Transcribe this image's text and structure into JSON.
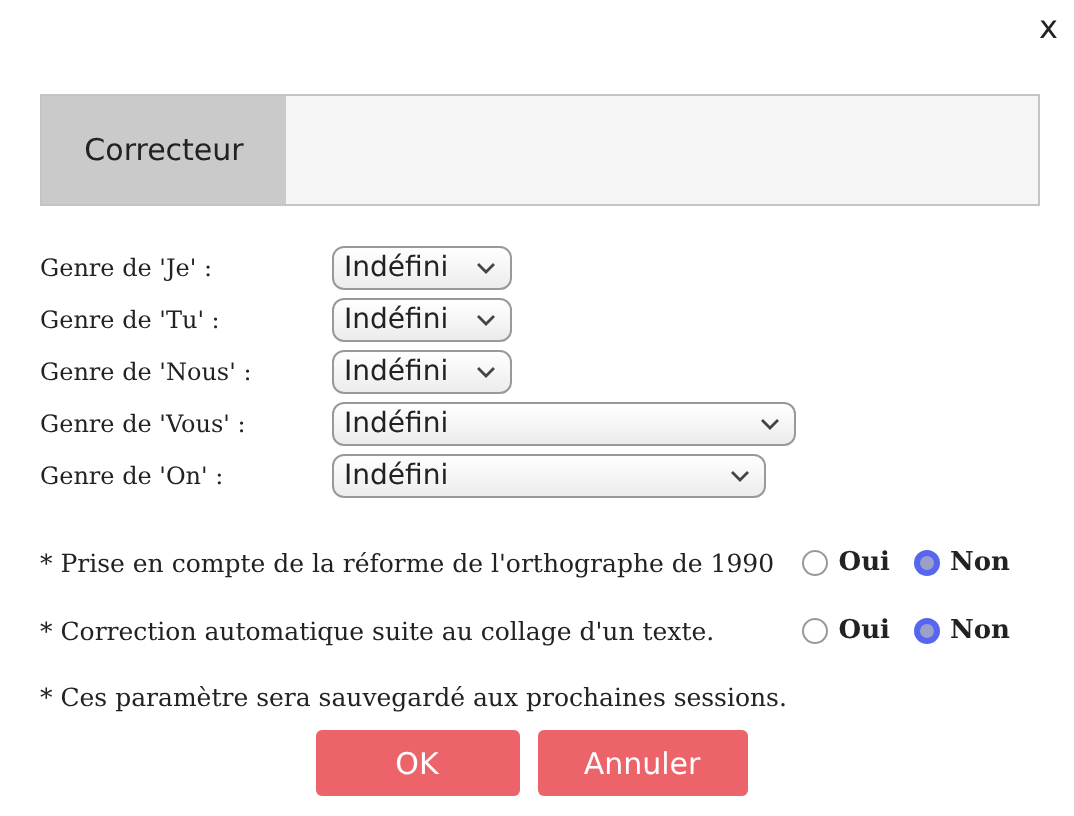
{
  "dialog": {
    "close": "x",
    "title": "Correcteur",
    "genders": [
      {
        "label": "Genre de 'Je' :",
        "value": "Indéfini"
      },
      {
        "label": "Genre de 'Tu' :",
        "value": "Indéfini"
      },
      {
        "label": "Genre de 'Nous' :",
        "value": "Indéfini"
      },
      {
        "label": "Genre de 'Vous' :",
        "value": "Indéfini"
      },
      {
        "label": "Genre de 'On' :",
        "value": "Indéfini"
      }
    ],
    "options": [
      {
        "label": "* Prise en compte de la réforme de l'orthographe de 1990",
        "choices": [
          {
            "label": "Oui",
            "selected": false
          },
          {
            "label": "Non",
            "selected": true
          }
        ]
      },
      {
        "label": "* Correction automatique suite au collage d'un texte.",
        "choices": [
          {
            "label": "Oui",
            "selected": false
          },
          {
            "label": "Non",
            "selected": true
          }
        ]
      }
    ],
    "note": "* Ces paramètre sera sauvegardé aux prochaines sessions.",
    "buttons": [
      "OK",
      "Annuler"
    ]
  }
}
